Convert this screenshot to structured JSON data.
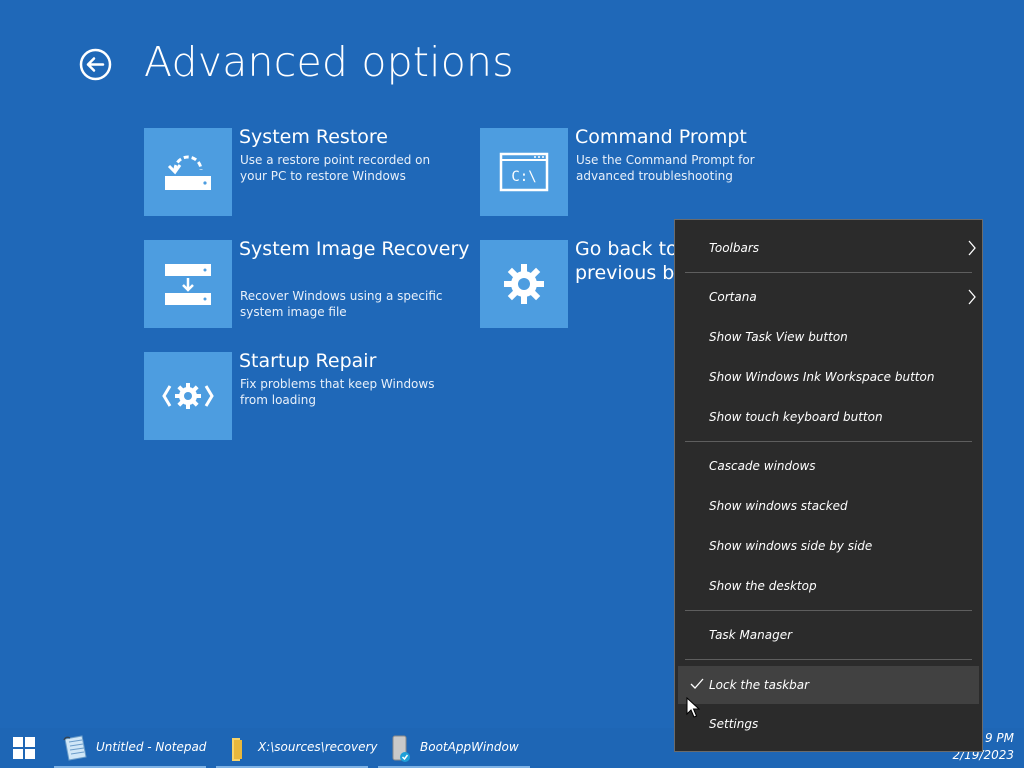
{
  "header": {
    "title": "Advanced options"
  },
  "tiles": [
    {
      "title": "System Restore",
      "description": "Use a restore point recorded on your PC to restore Windows",
      "icon": "system-restore-icon"
    },
    {
      "title": "Command Prompt",
      "description": "Use the Command Prompt for advanced troubleshooting",
      "icon": "command-prompt-icon"
    },
    {
      "title": "System Image Recovery",
      "description": "Recover Windows using a specific system image file",
      "icon": "system-image-icon"
    },
    {
      "title": "Go back to the previous build",
      "description": "",
      "icon": "gear-icon"
    },
    {
      "title": "Startup Repair",
      "description": "Fix problems that keep Windows from loading",
      "icon": "startup-repair-icon"
    }
  ],
  "context_menu": {
    "items": [
      {
        "label": "Toolbars",
        "submenu": true
      },
      {
        "label": "Cortana",
        "submenu": true
      },
      {
        "label": "Show Task View button"
      },
      {
        "label": "Show Windows Ink Workspace button"
      },
      {
        "label": "Show touch keyboard button"
      },
      {
        "label": "Cascade windows"
      },
      {
        "label": "Show windows stacked"
      },
      {
        "label": "Show windows side by side"
      },
      {
        "label": "Show the desktop"
      },
      {
        "label": "Task Manager"
      },
      {
        "label": "Lock the taskbar",
        "checked": true,
        "hovered": true
      },
      {
        "label": "Settings"
      }
    ]
  },
  "taskbar": {
    "items": [
      {
        "label": "Untitled - Notepad",
        "icon": "notepad-icon"
      },
      {
        "label": "X:\\sources\\recovery",
        "icon": "folder-icon"
      },
      {
        "label": "BootAppWindow",
        "icon": "boot-app-icon"
      }
    ],
    "clock": {
      "time": "9 PM",
      "date": "2/19/2023"
    }
  },
  "colors": {
    "background": "#1f68b8",
    "tile": "#4d9de0",
    "menu": "#2b2b2b"
  }
}
